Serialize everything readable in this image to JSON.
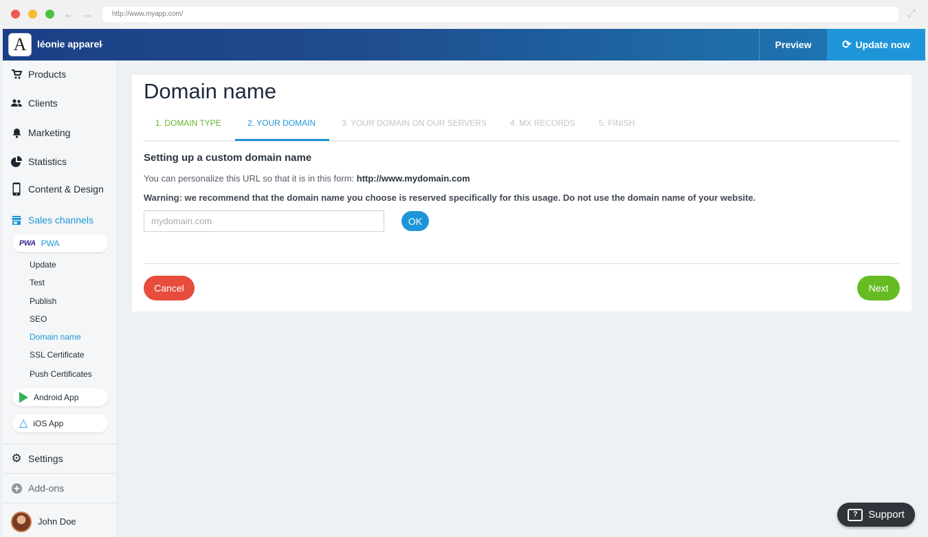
{
  "browser": {
    "url": "http://www.myapp.com/"
  },
  "header": {
    "store_name": "léonie apparel",
    "logo_letter": "A",
    "preview_label": "Preview",
    "update_label": "Update now"
  },
  "sidebar": {
    "items": [
      {
        "label": "Products",
        "icon": "cart-icon"
      },
      {
        "label": "Clients",
        "icon": "users-icon"
      },
      {
        "label": "Marketing",
        "icon": "bell-icon"
      },
      {
        "label": "Statistics",
        "icon": "pie-chart-icon"
      },
      {
        "label": "Content & Design",
        "icon": "phone-icon"
      },
      {
        "label": "Sales channels",
        "icon": "store-icon"
      }
    ],
    "pwa_label": "PWA",
    "pwa_logo": "PWA",
    "pwa_subitems": [
      "Update",
      "Test",
      "Publish",
      "SEO",
      "Domain name",
      "SSL Certificate",
      "Push Certificates"
    ],
    "android_label": "Android App",
    "ios_label": "iOS App",
    "settings_label": "Settings",
    "addons_label": "Add-ons",
    "user_name": "John Doe"
  },
  "main": {
    "title": "Domain name",
    "tabs": [
      "1. DOMAIN TYPE",
      "2. YOUR DOMAIN",
      "3. YOUR DOMAIN ON OUR SERVERS",
      "4. MX RECORDS",
      "5. FINISH"
    ],
    "section_title": "Setting up a custom domain name",
    "description_prefix": "You can personalize this URL so that it is in this form:",
    "description_url": "http://www.mydomain.com",
    "warning": "Warning: we recommend that the domain name you choose is reserved specifically for this usage. Do not use the domain name of your website.",
    "input_placeholder": "mydomain.com",
    "ok_label": "OK",
    "cancel_label": "Cancel",
    "next_label": "Next"
  },
  "support": {
    "label": "Support",
    "icon_glyph": "?"
  },
  "colors": {
    "accent": "#1e95d8",
    "success": "#66bb22",
    "danger": "#e74c3c"
  }
}
